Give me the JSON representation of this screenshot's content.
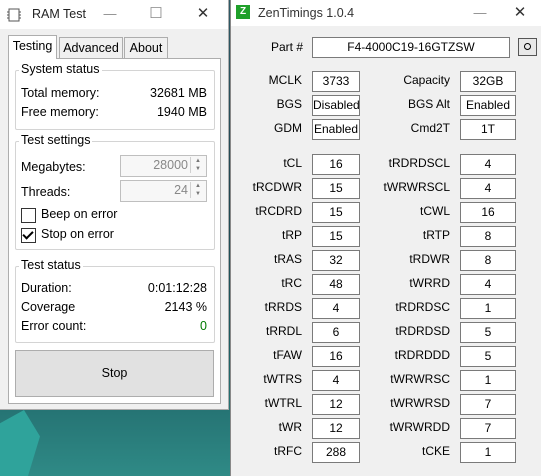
{
  "ramtest": {
    "title": "RAM Test",
    "tabs": [
      "Testing",
      "Advanced",
      "About"
    ],
    "system_status": {
      "title": "System status",
      "total_memory_label": "Total memory:",
      "total_memory_value": "32681 MB",
      "free_memory_label": "Free memory:",
      "free_memory_value": "1940 MB"
    },
    "test_settings": {
      "title": "Test settings",
      "megabytes_label": "Megabytes:",
      "megabytes_value": "28000",
      "threads_label": "Threads:",
      "threads_value": "24",
      "beep_label": "Beep on error",
      "beep_checked": false,
      "stop_label": "Stop on error",
      "stop_checked": true
    },
    "test_status": {
      "title": "Test status",
      "duration_label": "Duration:",
      "duration_value": "0:01:12:28",
      "coverage_label": "Coverage",
      "coverage_value": "2143 %",
      "errors_label": "Error count:",
      "errors_value": "0"
    },
    "stop_button": "Stop"
  },
  "zentimings": {
    "title": "ZenTimings 1.0.4",
    "logo_letter": "Z",
    "part_label": "Part #",
    "part_value": "F4-4000C19-16GTZSW",
    "info": [
      {
        "left_label": "MCLK",
        "left_value": "3733",
        "right_label": "Capacity",
        "right_value": "32GB"
      },
      {
        "left_label": "BGS",
        "left_value": "Disabled",
        "right_label": "BGS Alt",
        "right_value": "Enabled"
      },
      {
        "left_label": "GDM",
        "left_value": "Enabled",
        "right_label": "Cmd2T",
        "right_value": "1T"
      }
    ],
    "timings": [
      {
        "left_label": "tCL",
        "left_value": "16",
        "right_label": "tRDRDSCL",
        "right_value": "4"
      },
      {
        "left_label": "tRCDWR",
        "left_value": "15",
        "right_label": "tWRWRSCL",
        "right_value": "4"
      },
      {
        "left_label": "tRCDRD",
        "left_value": "15",
        "right_label": "tCWL",
        "right_value": "16"
      },
      {
        "left_label": "tRP",
        "left_value": "15",
        "right_label": "tRTP",
        "right_value": "8"
      },
      {
        "left_label": "tRAS",
        "left_value": "32",
        "right_label": "tRDWR",
        "right_value": "8"
      },
      {
        "left_label": "tRC",
        "left_value": "48",
        "right_label": "tWRRD",
        "right_value": "4"
      },
      {
        "left_label": "tRRDS",
        "left_value": "4",
        "right_label": "tRDRDSC",
        "right_value": "1"
      },
      {
        "left_label": "tRRDL",
        "left_value": "6",
        "right_label": "tRDRDSD",
        "right_value": "5"
      },
      {
        "left_label": "tFAW",
        "left_value": "16",
        "right_label": "tRDRDDD",
        "right_value": "5"
      },
      {
        "left_label": "tWTRS",
        "left_value": "4",
        "right_label": "tWRWRSC",
        "right_value": "1"
      },
      {
        "left_label": "tWTRL",
        "left_value": "12",
        "right_label": "tWRWRSD",
        "right_value": "7"
      },
      {
        "left_label": "tWR",
        "left_value": "12",
        "right_label": "tWRWRDD",
        "right_value": "7"
      },
      {
        "left_label": "tRFC",
        "left_value": "288",
        "right_label": "tCKE",
        "right_value": "1"
      }
    ]
  }
}
